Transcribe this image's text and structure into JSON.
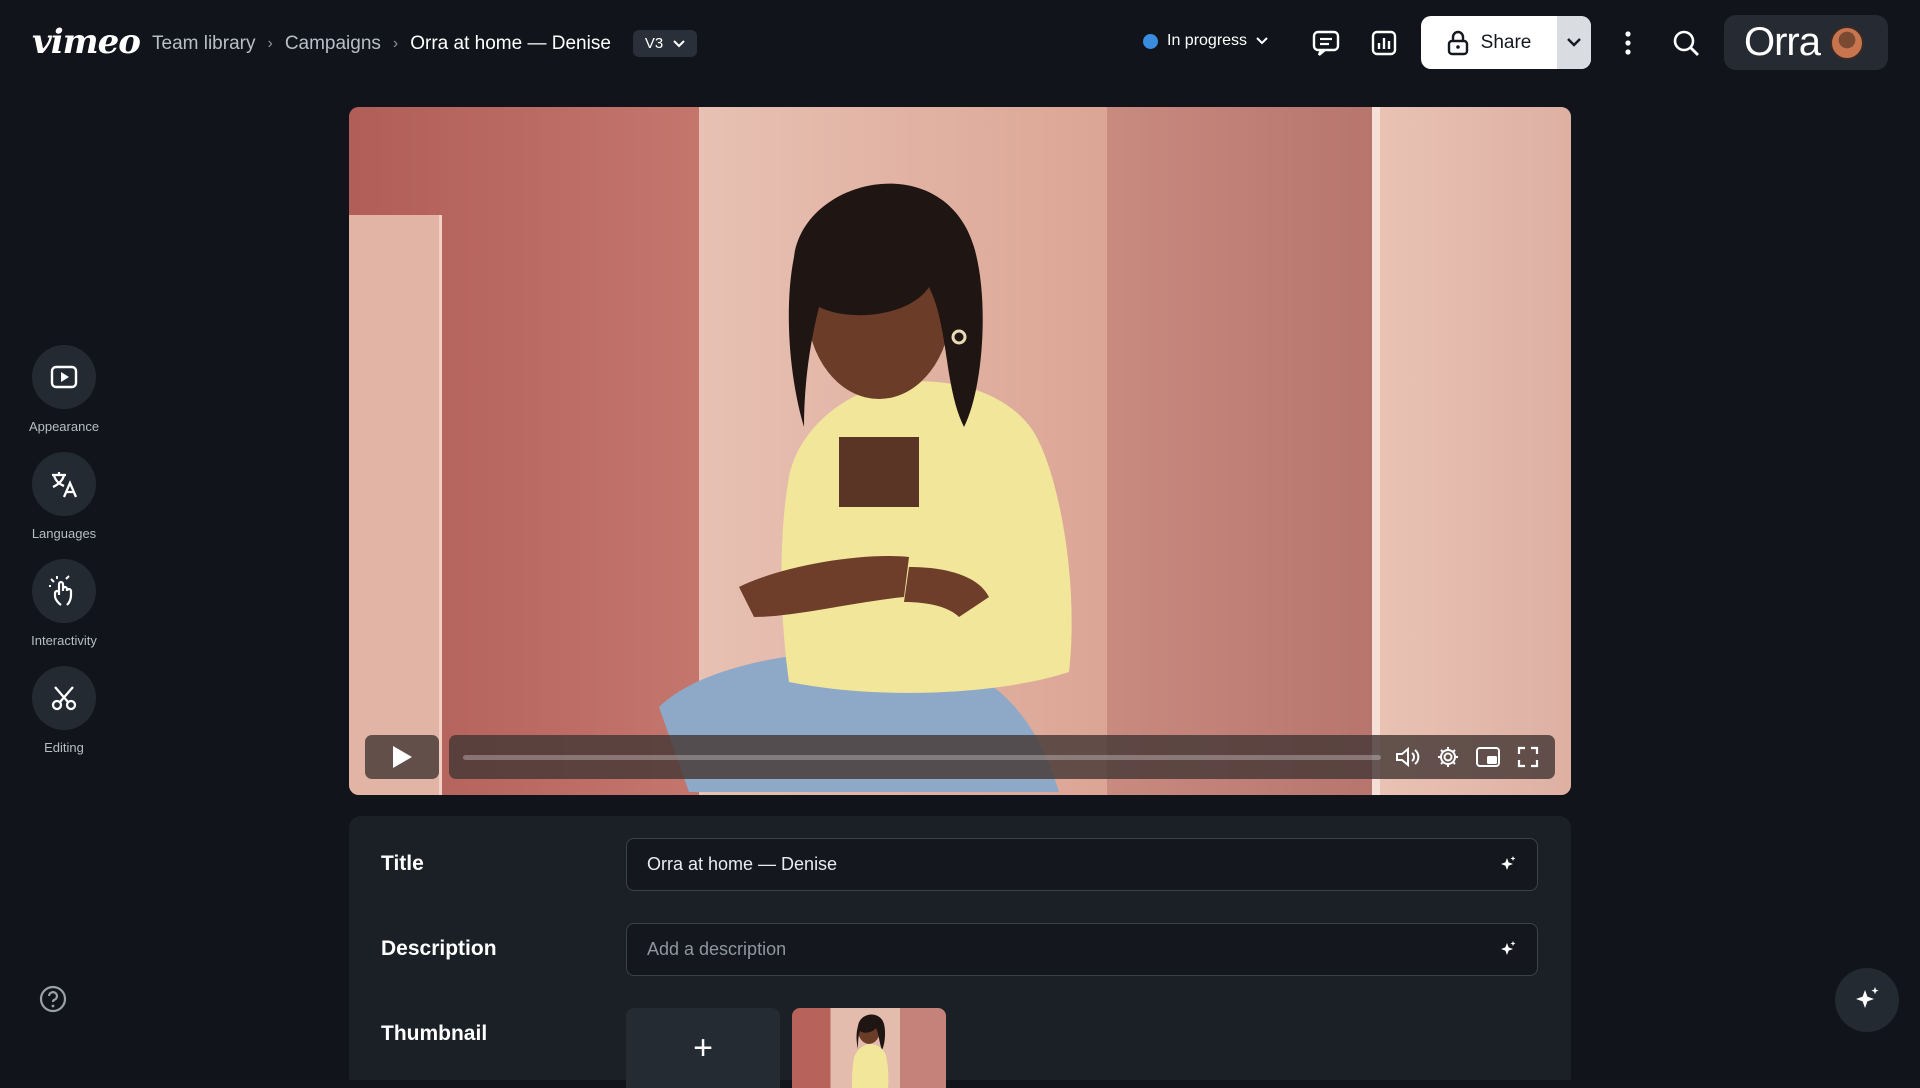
{
  "brand": {
    "logo_text": "vimeo",
    "workspace_text": "Orra"
  },
  "breadcrumb": {
    "items": [
      "Team library",
      "Campaigns"
    ],
    "current": "Orra at home — Denise",
    "separator": "›"
  },
  "version": {
    "label": "V3"
  },
  "status": {
    "label": "In progress",
    "color": "#3a8dde"
  },
  "share": {
    "label": "Share"
  },
  "sidebar": {
    "items": [
      {
        "label": "Appearance",
        "icon": "play-square-icon"
      },
      {
        "label": "Languages",
        "icon": "translate-icon"
      },
      {
        "label": "Interactivity",
        "icon": "hand-pointer-icon"
      },
      {
        "label": "Editing",
        "icon": "scissors-icon"
      }
    ]
  },
  "player": {
    "progress": 0
  },
  "details": {
    "title_label": "Title",
    "title_value": "Orra at home — Denise",
    "description_label": "Description",
    "description_placeholder": "Add a description",
    "thumbnail_label": "Thumbnail",
    "thumbnail_add_symbol": "+"
  },
  "colors": {
    "background": "#11151b",
    "panel": "#1b2027",
    "accent": "#3a8dde"
  }
}
